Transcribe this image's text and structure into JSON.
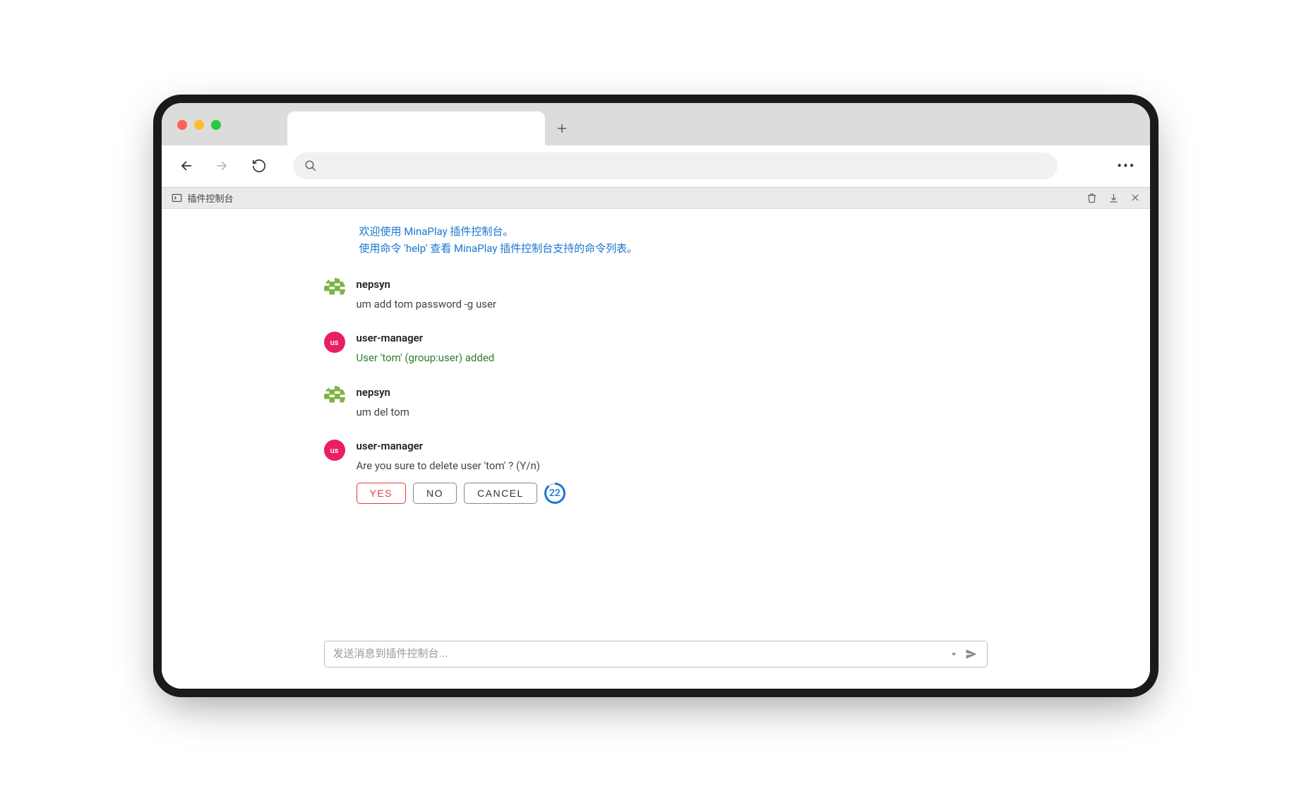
{
  "header": {
    "title": "插件控制台",
    "avatar_us_label": "us"
  },
  "welcome": {
    "line1": "欢迎使用 MinaPlay 插件控制台。",
    "line2": "使用命令 'help' 查看 MinaPlay 插件控制台支持的命令列表。"
  },
  "messages": [
    {
      "avatar_type": "pixel",
      "name": "nepsyn",
      "text": "um add tom password -g user",
      "text_class": ""
    },
    {
      "avatar_type": "us",
      "name": "user-manager",
      "text": "User 'tom' (group:user) added",
      "text_class": "success"
    },
    {
      "avatar_type": "pixel",
      "name": "nepsyn",
      "text": "um del tom",
      "text_class": ""
    },
    {
      "avatar_type": "us",
      "name": "user-manager",
      "text": "Are you sure to delete user 'tom' ? (Y/n)",
      "text_class": "",
      "actions": true
    }
  ],
  "actions": {
    "yes": "YES",
    "no": "NO",
    "cancel": "CANCEL",
    "countdown": "22"
  },
  "input": {
    "placeholder": "发送消息到插件控制台..."
  }
}
